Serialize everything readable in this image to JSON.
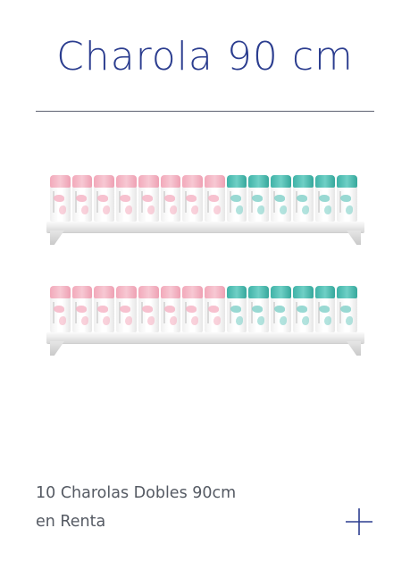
{
  "header": {
    "title": "Charola 90 cm"
  },
  "product": {
    "caption_line1": "10 Charolas Dobles 90cm",
    "caption_line2": "en Renta"
  },
  "shelves": [
    {
      "bottles": [
        "pink",
        "pink",
        "pink",
        "pink",
        "pink",
        "pink",
        "pink",
        "pink",
        "teal",
        "teal",
        "teal",
        "teal",
        "teal",
        "teal"
      ]
    },
    {
      "bottles": [
        "pink",
        "pink",
        "pink",
        "pink",
        "pink",
        "pink",
        "pink",
        "pink",
        "teal",
        "teal",
        "teal",
        "teal",
        "teal",
        "teal"
      ]
    }
  ],
  "colors": {
    "title": "#2b3d8f",
    "caption": "#555a63",
    "plus_icon": "#2b3d8f",
    "cap_pink": "#f2a9ba",
    "cap_teal": "#3fb2a7"
  },
  "icons": {
    "expand": "plus-icon"
  }
}
